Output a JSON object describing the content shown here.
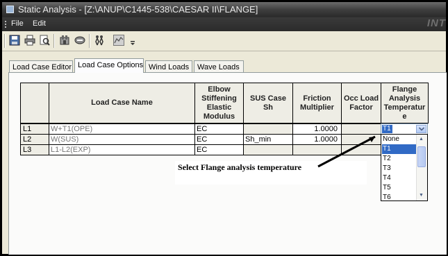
{
  "window": {
    "title": "Static Analysis - [Z:\\ANUP\\C1445-538\\CAESAR II\\FLANGE]",
    "logo_text": "INT"
  },
  "menu": {
    "file": "File",
    "edit": "Edit"
  },
  "tabs": [
    "Load Case Editor",
    "Load Case Options",
    "Wind Loads",
    "Wave Loads"
  ],
  "active_tab": "Load Case Options",
  "columns": [
    "Load Case Name",
    "Elbow\nStiffening\nElastic\nModulus",
    "SUS Case\nSh",
    "Friction\nMultiplier",
    "Occ Load\nFactor",
    "Flange\nAnalysis\nTemperatur\ne"
  ],
  "rows": [
    {
      "id": "L1",
      "name": "W+T1(OPE)",
      "elbow": "EC",
      "sus": "",
      "friction": "1.0000",
      "occ": ""
    },
    {
      "id": "L2",
      "name": "W(SUS)",
      "elbow": "EC",
      "sus": "Sh_min",
      "friction": "1.0000",
      "occ": ""
    },
    {
      "id": "L3",
      "name": "L1-L2(EXP)",
      "elbow": "EC",
      "sus": "",
      "friction": "",
      "occ": ""
    }
  ],
  "combo_value": "T1",
  "dropdown_options": [
    "None",
    "T1",
    "T2",
    "T3",
    "T4",
    "T5",
    "T6"
  ],
  "dropdown_selected": "T1",
  "annotation": "Select Flange analysis temperature"
}
